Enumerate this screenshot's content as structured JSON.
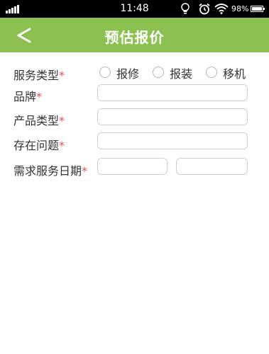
{
  "status_bar": {
    "time": "11:48",
    "battery": "98%",
    "icons": [
      "signal-icon",
      "lightbulb-icon",
      "alarm-icon",
      "wifi-icon",
      "battery-icon"
    ]
  },
  "header": {
    "back_icon": "chevron-left-icon",
    "back_glyph": "<",
    "title": "预估报价",
    "background": "#8cc152"
  },
  "form": {
    "required_mark": "*",
    "required_color": "#d9534f",
    "service_type": {
      "label": "服务类型",
      "options": [
        "报修",
        "报装",
        "移机"
      ]
    },
    "brand": {
      "label": "品牌",
      "value": ""
    },
    "product_type": {
      "label": "产品类型",
      "value": ""
    },
    "issue": {
      "label": "存在问题",
      "value": ""
    },
    "service_date": {
      "label": "需求服务日期",
      "date_value": "",
      "time_value": ""
    }
  }
}
